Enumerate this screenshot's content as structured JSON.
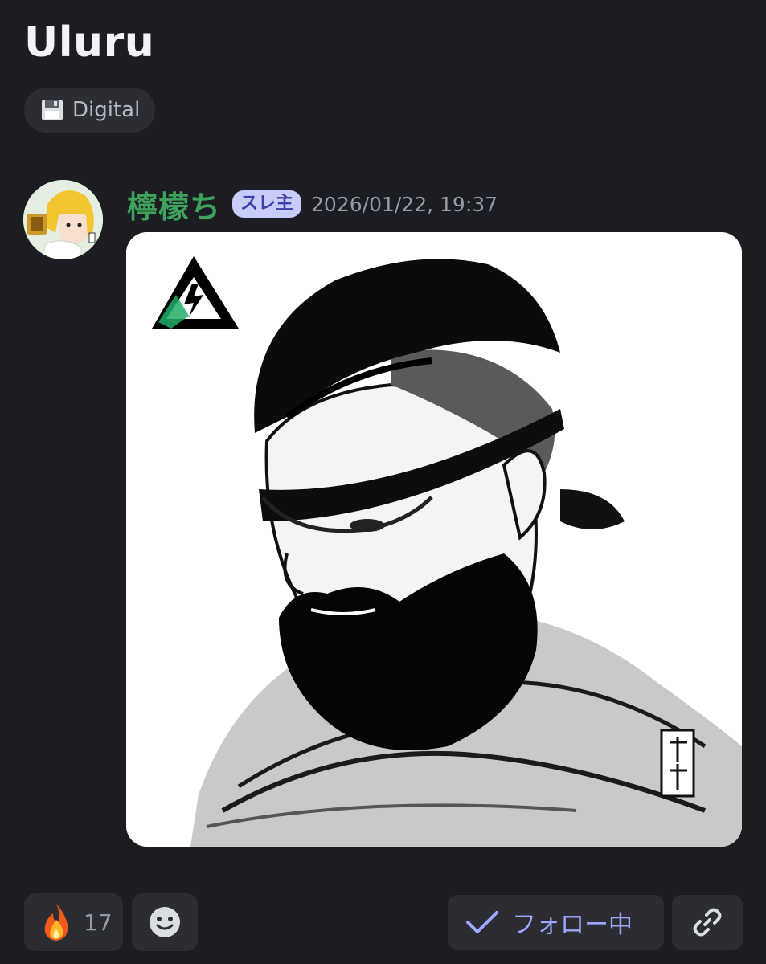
{
  "thread": {
    "title": "Uluru",
    "tag": {
      "icon": "floppy-disk-icon",
      "label": "Digital"
    }
  },
  "post": {
    "author": "檸檬ち",
    "author_color": "#3ea35a",
    "op_badge": "スレ主",
    "timestamp": "2026/01/22, 19:37",
    "attachment": {
      "type": "image",
      "signature": "檸檬ち"
    }
  },
  "actions": {
    "reaction": {
      "emoji": "🔥",
      "count": "17"
    },
    "add_reaction_icon": "smiley-face-icon",
    "follow": {
      "icon": "checkmark-icon",
      "label": "フォロー中"
    },
    "link_icon": "link-icon"
  },
  "colors": {
    "background": "#1c1d23",
    "surface": "#2b2d33",
    "accent": "#9ea6ff",
    "badge_bg": "#c9ccf8",
    "muted": "#949ba4"
  }
}
